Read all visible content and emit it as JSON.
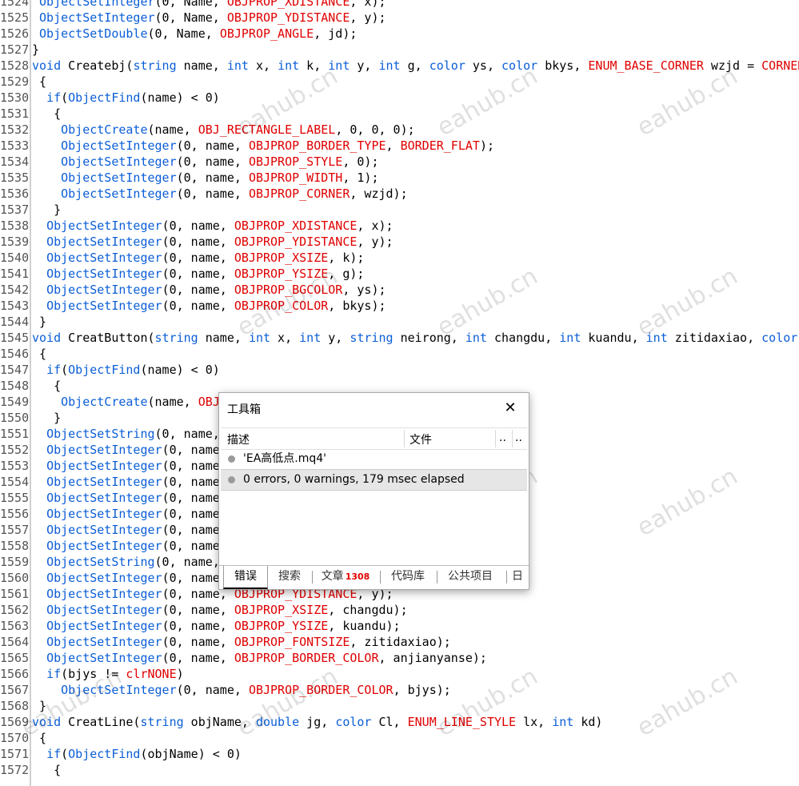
{
  "code_lines": [
    {
      "n": "1524",
      "t": " <f>ObjectSetInteger</f>(0, Name, <c>OBJPROP_XDISTANCE</c>, x);"
    },
    {
      "n": "1525",
      "t": " <f>ObjectSetInteger</f>(0, Name, <c>OBJPROP_YDISTANCE</c>, y);"
    },
    {
      "n": "1526",
      "t": " <f>ObjectSetDouble</f>(0, Name, <c>OBJPROP_ANGLE</c>, jd);"
    },
    {
      "n": "1527",
      "t": "}"
    },
    {
      "n": "1528",
      "t": "<k>void</k> Createbj(<k>string</k> name, <k>int</k> x, <k>int</k> k, <k>int</k> y, <k>int</k> g, <k>color</k> ys, <k>color</k> bkys, <c>ENUM_BASE_CORNER</c> wzjd = <c>CORNER_LEFT_UPPER</c>)"
    },
    {
      "n": "1529",
      "t": " {"
    },
    {
      "n": "1530",
      "t": "  <k>if</k>(<f>ObjectFind</f>(name) < 0)"
    },
    {
      "n": "1531",
      "t": "   {"
    },
    {
      "n": "1532",
      "t": "    <f>ObjectCreate</f>(name, <c>OBJ_RECTANGLE_LABEL</c>, 0, 0, 0);"
    },
    {
      "n": "1533",
      "t": "    <f>ObjectSetInteger</f>(0, name, <c>OBJPROP_BORDER_TYPE</c>, <c>BORDER_FLAT</c>);"
    },
    {
      "n": "1534",
      "t": "    <f>ObjectSetInteger</f>(0, name, <c>OBJPROP_STYLE</c>, 0);"
    },
    {
      "n": "1535",
      "t": "    <f>ObjectSetInteger</f>(0, name, <c>OBJPROP_WIDTH</c>, 1);"
    },
    {
      "n": "1536",
      "t": "    <f>ObjectSetInteger</f>(0, name, <c>OBJPROP_CORNER</c>, wzjd);"
    },
    {
      "n": "1537",
      "t": "   }"
    },
    {
      "n": "1538",
      "t": "  <f>ObjectSetInteger</f>(0, name, <c>OBJPROP_XDISTANCE</c>, x);"
    },
    {
      "n": "1539",
      "t": "  <f>ObjectSetInteger</f>(0, name, <c>OBJPROP_YDISTANCE</c>, y);"
    },
    {
      "n": "1540",
      "t": "  <f>ObjectSetInteger</f>(0, name, <c>OBJPROP_XSIZE</c>, k);"
    },
    {
      "n": "1541",
      "t": "  <f>ObjectSetInteger</f>(0, name, <c>OBJPROP_YSIZE</c>, g);"
    },
    {
      "n": "1542",
      "t": "  <f>ObjectSetInteger</f>(0, name, <c>OBJPROP_BGCOLOR</c>, ys);"
    },
    {
      "n": "1543",
      "t": "  <f>ObjectSetInteger</f>(0, name, <c>OBJPROP_COLOR</c>, bkys);"
    },
    {
      "n": "1544",
      "t": " }"
    },
    {
      "n": "1545",
      "t": "<k>void</k> CreatButton(<k>string</k> name, <k>int</k> x, <k>int</k> y, <k>string</k> neirong, <k>int</k> changdu, <k>int</k> kuandu, <k>int</k> zitidaxiao, <k>color</k> anjianyanse"
    },
    {
      "n": "1546",
      "t": " {"
    },
    {
      "n": "1547",
      "t": "  <k>if</k>(<f>ObjectFind</f>(name) < 0)"
    },
    {
      "n": "1548",
      "t": "   {"
    },
    {
      "n": "1549",
      "t": "    <f>ObjectCreate</f>(name, <c>OBJ</c>"
    },
    {
      "n": "1550",
      "t": "   }"
    },
    {
      "n": "1551",
      "t": "  <f>ObjectSetString</f>(0, name,"
    },
    {
      "n": "1552",
      "t": "  <f>ObjectSetInteger</f>(0, name"
    },
    {
      "n": "1553",
      "t": "  <f>ObjectSetInteger</f>(0, name"
    },
    {
      "n": "1554",
      "t": "  <f>ObjectSetInteger</f>(0, name"
    },
    {
      "n": "1555",
      "t": "  <f>ObjectSetInteger</f>(0, name"
    },
    {
      "n": "1556",
      "t": "  <f>ObjectSetInteger</f>(0, name"
    },
    {
      "n": "1557",
      "t": "  <f>ObjectSetInteger</f>(0, name"
    },
    {
      "n": "1558",
      "t": "  <f>ObjectSetInteger</f>(0, name"
    },
    {
      "n": "1559",
      "t": "  <f>ObjectSetString</f>(0, name,"
    },
    {
      "n": "1560",
      "t": "  <f>ObjectSetInteger</f>(0, name"
    },
    {
      "n": "1561",
      "t": "  <f>ObjectSetInteger</f>(0, name, <c>OBJPROP_YDISTANCE</c>, y);"
    },
    {
      "n": "1562",
      "t": "  <f>ObjectSetInteger</f>(0, name, <c>OBJPROP_XSIZE</c>, changdu);"
    },
    {
      "n": "1563",
      "t": "  <f>ObjectSetInteger</f>(0, name, <c>OBJPROP_YSIZE</c>, kuandu);"
    },
    {
      "n": "1564",
      "t": "  <f>ObjectSetInteger</f>(0, name, <c>OBJPROP_FONTSIZE</c>, zitidaxiao);"
    },
    {
      "n": "1565",
      "t": "  <f>ObjectSetInteger</f>(0, name, <c>OBJPROP_BORDER_COLOR</c>, anjianyanse);"
    },
    {
      "n": "1566",
      "t": "  <k>if</k>(bjys != <c>clrNONE</c>)"
    },
    {
      "n": "1567",
      "t": "    <f>ObjectSetInteger</f>(0, name, <c>OBJPROP_BORDER_COLOR</c>, bjys);"
    },
    {
      "n": "1568",
      "t": " }"
    },
    {
      "n": "1569",
      "t": "<k>void</k> CreatLine(<k>string</k> objName, <k>double</k> jg, <k>color</k> Cl, <c>ENUM_LINE_STYLE</c> lx, <k>int</k> kd)"
    },
    {
      "n": "1570",
      "t": " {"
    },
    {
      "n": "1571",
      "t": "  <k>if</k>(<f>ObjectFind</f>(objName) < 0)"
    },
    {
      "n": "1572",
      "t": "   {"
    }
  ],
  "watermark": "eahub.cn",
  "toolbox": {
    "title": "工具箱",
    "columns": {
      "desc": "描述",
      "file": "文件",
      "c3": "..",
      "c4": ".."
    },
    "rows": [
      {
        "text": "'EA高低点.mq4'",
        "selected": false
      },
      {
        "text": "0 errors, 0 warnings, 179 msec elapsed",
        "selected": true
      }
    ],
    "tabs": [
      {
        "label": "错误",
        "active": true
      },
      {
        "label": "搜索",
        "active": false
      },
      {
        "label": "文章",
        "badge": "1308",
        "active": false
      },
      {
        "label": "代码库",
        "active": false
      },
      {
        "label": "公共项目",
        "active": false
      },
      {
        "label": "日",
        "active": false
      }
    ]
  },
  "colors": {
    "function": "#0b5ed7",
    "keyword": "#0b5ed7",
    "constant": "#e00000"
  }
}
